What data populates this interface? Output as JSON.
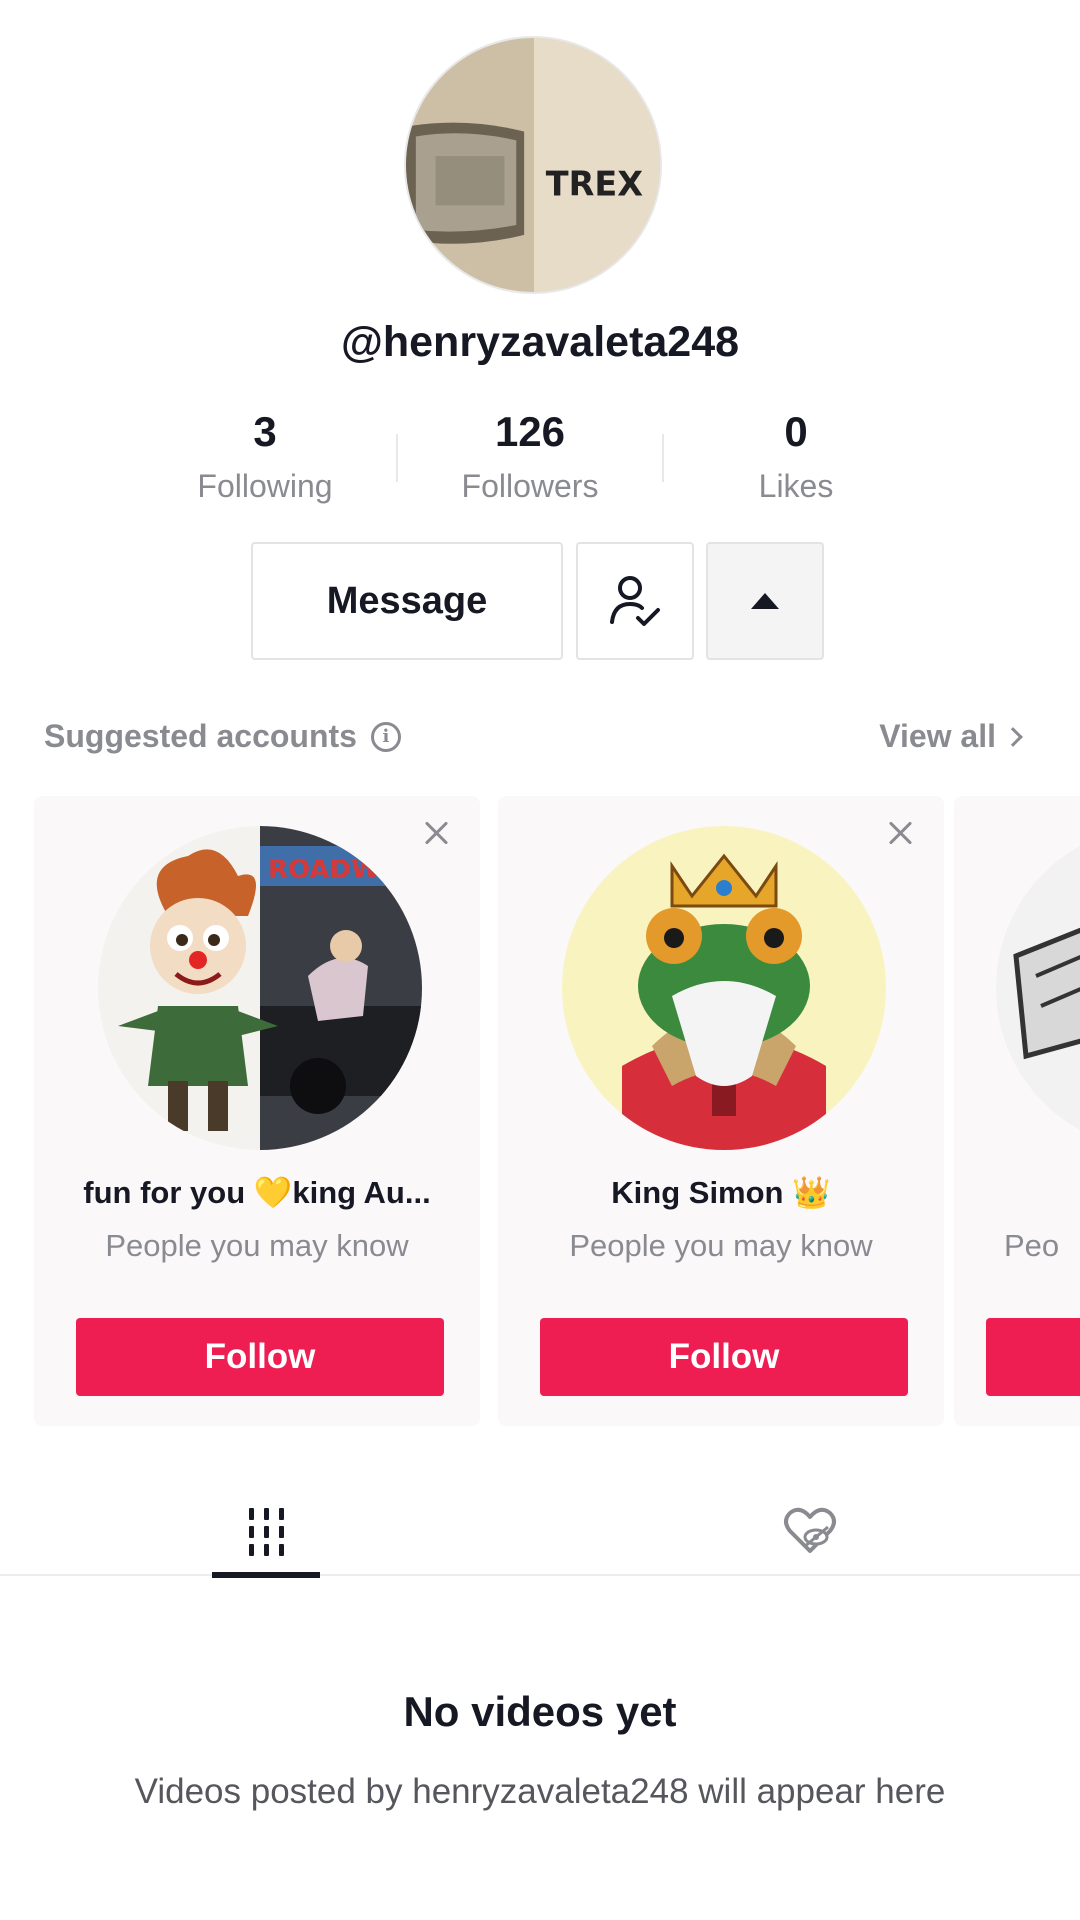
{
  "profile": {
    "username": "@henryzavaleta248",
    "avatar_text": "TREX"
  },
  "stats": [
    {
      "value": "3",
      "label": "Following"
    },
    {
      "value": "126",
      "label": "Followers"
    },
    {
      "value": "0",
      "label": "Likes"
    }
  ],
  "actions": {
    "message_label": "Message",
    "friends_icon": "person-check-icon",
    "more_icon": "triangle-up-icon"
  },
  "suggested": {
    "title": "Suggested accounts",
    "view_all": "View all",
    "cards": [
      {
        "name": "fun for you 💛king Au...",
        "subtitle": "People you may know",
        "follow_label": "Follow",
        "pic_text": "ROADWA"
      },
      {
        "name": "King Simon 👑",
        "subtitle": "People you may know",
        "follow_label": "Follow"
      },
      {
        "subtitle": "Peo",
        "follow_label": ""
      }
    ]
  },
  "tabs": {
    "videos_icon": "grid-icon",
    "liked_icon": "heart-hidden-icon"
  },
  "empty": {
    "title": "No videos yet",
    "subtitle": "Videos posted by henryzavaleta248 will appear here"
  },
  "colors": {
    "accent": "#ee1d52",
    "text_primary": "#161823",
    "text_secondary": "#8a8b91"
  }
}
